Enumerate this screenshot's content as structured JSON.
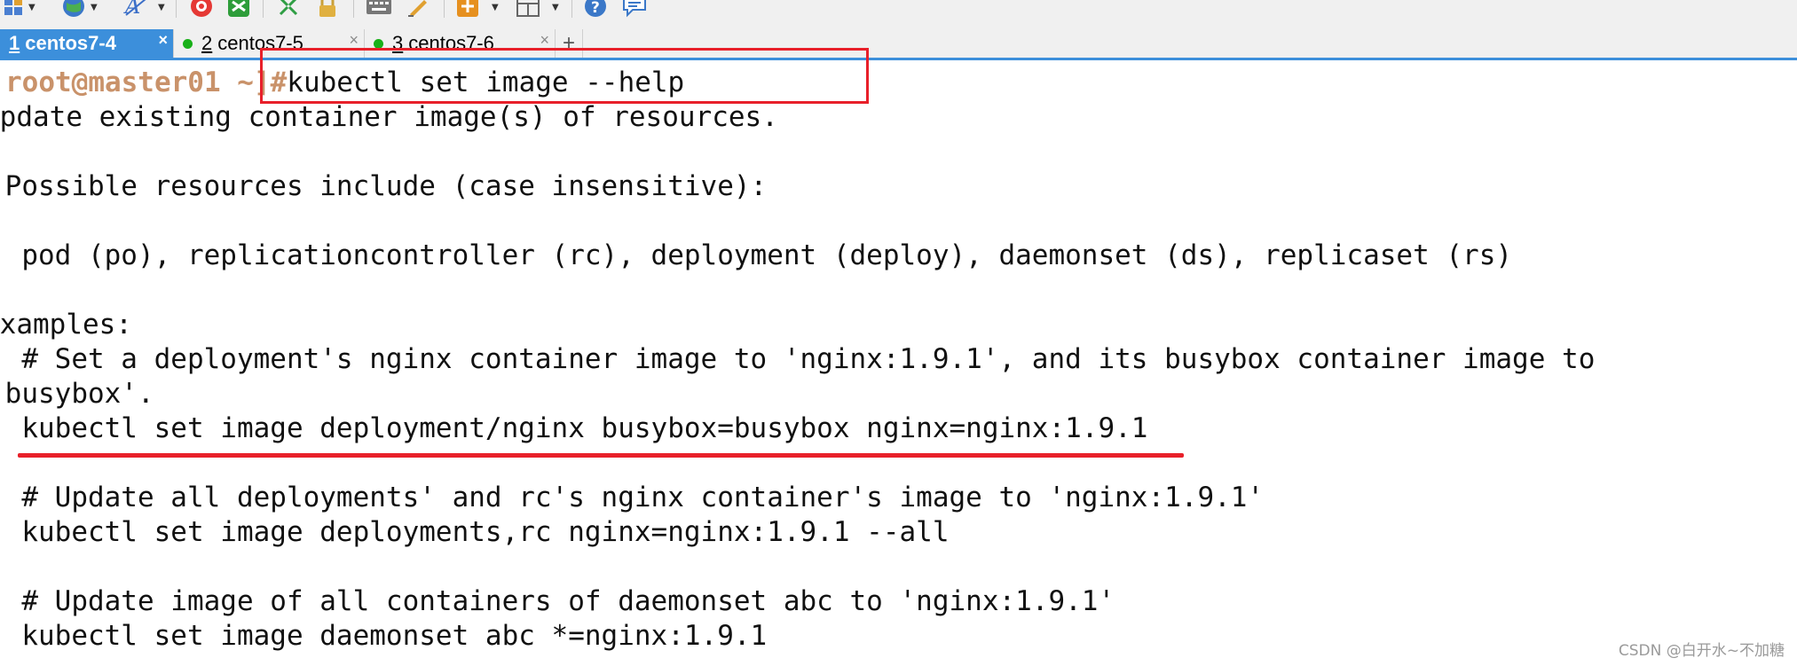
{
  "toolbar": {
    "icons": [
      "new-session-icon",
      "globe-icon",
      "font-icon",
      "record-icon",
      "xftp-icon",
      "transfer-icon",
      "lock-icon",
      "keyboard-icon",
      "highlight-pen-icon",
      "add-icon",
      "layout-icon",
      "help-icon",
      "chat-icon"
    ]
  },
  "tabs": [
    {
      "number": "1",
      "label": "centos7-4",
      "active": true
    },
    {
      "number": "2",
      "label": "centos7-5",
      "active": false
    },
    {
      "number": "3",
      "label": "centos7-6",
      "active": false
    }
  ],
  "tab_add_label": "+",
  "tab_close_label": "×",
  "terminal": {
    "prompt": {
      "user_host": "root@master01",
      "path": " ~",
      "marker": "]#"
    },
    "command": "kubectl set image --help",
    "lines": [
      "Update existing container image(s) of resources.",
      "",
      " Possible resources include (case insensitive):",
      "",
      "  pod (po), replicationcontroller (rc), deployment (deploy), daemonset (ds), replicaset (rs)",
      "",
      "Examples:",
      "  # Set a deployment's nginx container image to 'nginx:1.9.1', and its busybox container image to",
      " busybox'.",
      "  kubectl set image deployment/nginx busybox=busybox nginx=nginx:1.9.1",
      "",
      "  # Update all deployments' and rc's nginx container's image to 'nginx:1.9.1'",
      "  kubectl set image deployments,rc nginx=nginx:1.9.1 --all",
      "",
      "  # Update image of all containers of daemonset abc to 'nginx:1.9.1'",
      "  kubectl set image daemonset abc *=nginx:1.9.1"
    ]
  },
  "watermark": "CSDN @白开水~不加糖",
  "colors": {
    "accent": "#3c8fdb",
    "annotation": "#e8202a",
    "prompt": "#c9926a",
    "tab_dot": "#19b019"
  }
}
